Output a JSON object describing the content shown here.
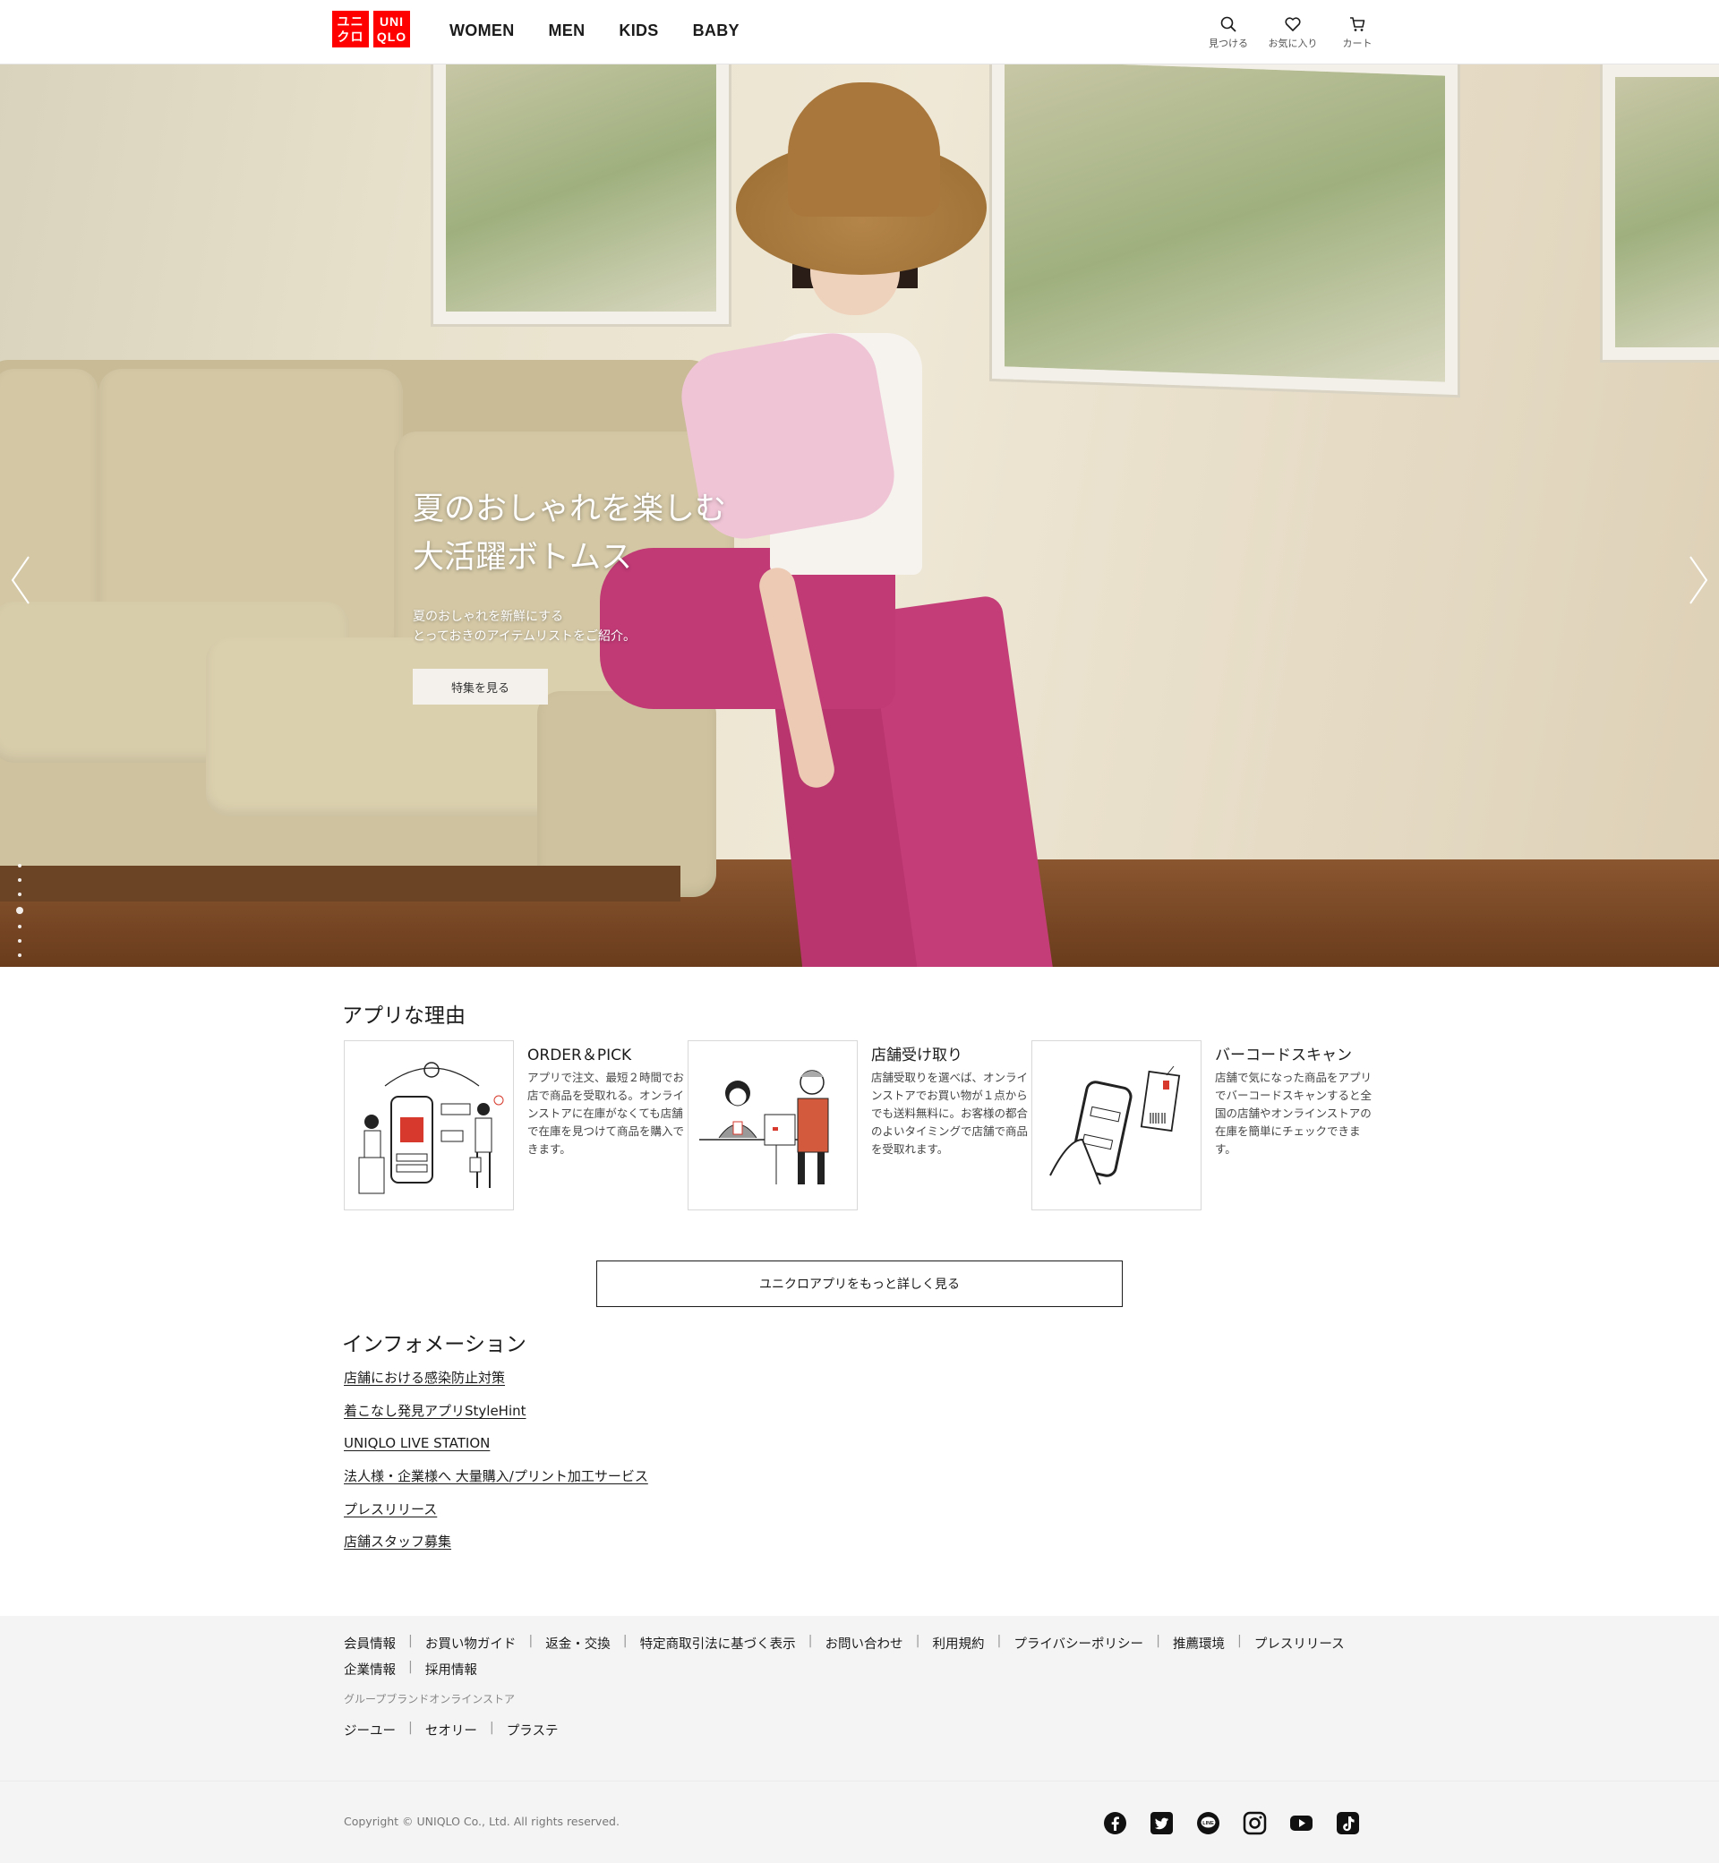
{
  "header": {
    "logo": [
      "ユニ\nクロ",
      "UNI\nQLO"
    ],
    "nav": [
      "WOMEN",
      "MEN",
      "KIDS",
      "BABY"
    ],
    "icons": [
      {
        "icon": "search-icon",
        "label": "見つける"
      },
      {
        "icon": "heart-icon",
        "label": "お気に入り"
      },
      {
        "icon": "cart-icon",
        "label": "カート"
      }
    ]
  },
  "hero": {
    "title": "夏のおしゃれを楽しむ\n大活躍ボトムス",
    "subtitle": "夏のおしゃれを新鮮にする\nとっておきのアイテムリストをご紹介。",
    "button": "特集を見る",
    "vertical_dots": 8,
    "vertical_active": 3,
    "horizontal_dots": 4,
    "horizontal_active": 0
  },
  "app_section": {
    "title": "アプリな理由",
    "cards": [
      {
        "title": "ORDER＆PICK",
        "desc": "アプリで注文、最短２時間でお店で商品を受取れる。オンラインストアに在庫がなくても店舗で在庫を見つけて商品を購入できます。"
      },
      {
        "title": "店舗受け取り",
        "desc": "店舗受取りを選べば、オンラインストアでお買い物が１点からでも送料無料に。お客様の都合のよいタイミングで店舗で商品を受取れます。"
      },
      {
        "title": "バーコードスキャン",
        "desc": "店舗で気になった商品をアプリでバーコードスキャンすると全国の店舗やオンラインストアの在庫を簡単にチェックできます。"
      }
    ],
    "more_button": "ユニクロアプリをもっと詳しく見る"
  },
  "info": {
    "title": "インフォメーション",
    "links": [
      "店舗における感染防止対策",
      "着こなし発見アプリStyleHint",
      "UNIQLO LIVE STATION",
      "法人様・企業様へ 大量購入/プリント加工サービス",
      "プレスリリース",
      "店舗スタッフ募集"
    ]
  },
  "footer": {
    "row1": [
      "会員情報",
      "お買い物ガイド",
      "返金・交換",
      "特定商取引法に基づく表示",
      "お問い合わせ",
      "利用規約",
      "プライバシーポリシー",
      "推薦環境",
      "プレスリリース"
    ],
    "row2": [
      "企業情報",
      "採用情報"
    ],
    "group_label": "グループブランドオンラインストア",
    "group_links": [
      "ジーユー",
      "セオリー",
      "プラステ"
    ],
    "copyright": "Copyright © UNIQLO Co., Ltd. All rights reserved.",
    "social": [
      "facebook-icon",
      "twitter-icon",
      "line-icon",
      "instagram-icon",
      "youtube-icon",
      "tiktok-icon"
    ]
  }
}
